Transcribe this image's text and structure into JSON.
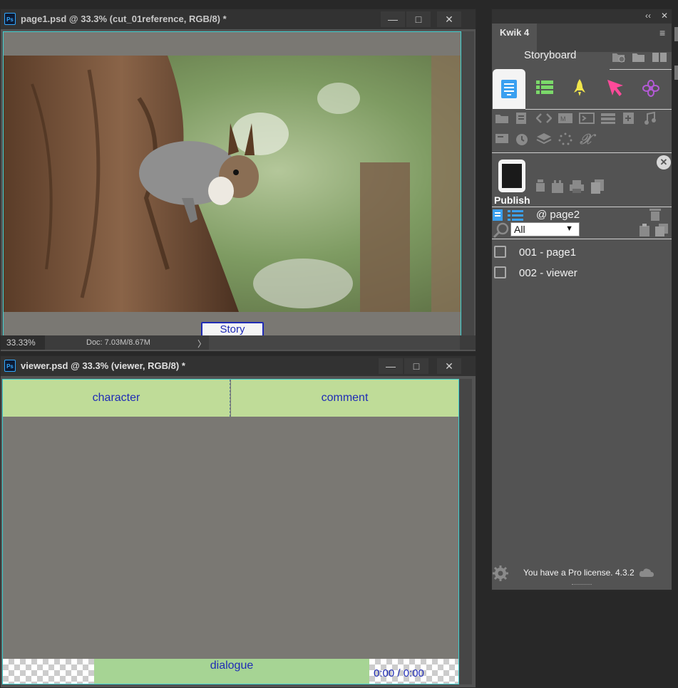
{
  "window1": {
    "title": "page1.psd @ 33.3% (cut_01reference, RGB/8) *",
    "app_icon": "Ps",
    "story_button": "Story",
    "zoom": "33.33%",
    "doc_info": "Doc: 7.03M/8.67M",
    "arrow": "〉"
  },
  "window2": {
    "title": "viewer.psd @ 33.3% (viewer, RGB/8) *",
    "app_icon": "Ps",
    "character_label": "character",
    "comment_label": "comment",
    "dialogue_label": "dialogue",
    "time_label": "0:00 / 0:00"
  },
  "window_buttons": {
    "minimize": "—",
    "maximize": "□",
    "close": "✕"
  },
  "panel": {
    "collapse": "‹‹",
    "close": "✕",
    "tab": "Kwik 4",
    "menu": "≡",
    "section_title": "Storyboard",
    "publish_label": "Publish",
    "page_name": "@ page2",
    "filter_selected": "All",
    "filter_arrow": "▼",
    "items": [
      {
        "label": "001 - page1"
      },
      {
        "label": "002 - viewer"
      }
    ],
    "license": "You have a Pro license. 4.3.2",
    "colors": {
      "green": "#7bd86a",
      "yellow": "#f1e64b",
      "pink": "#ff4a9a",
      "purple": "#b45ad6",
      "blue": "#3aa0f0",
      "accent_border": "#3fd1d1"
    }
  }
}
